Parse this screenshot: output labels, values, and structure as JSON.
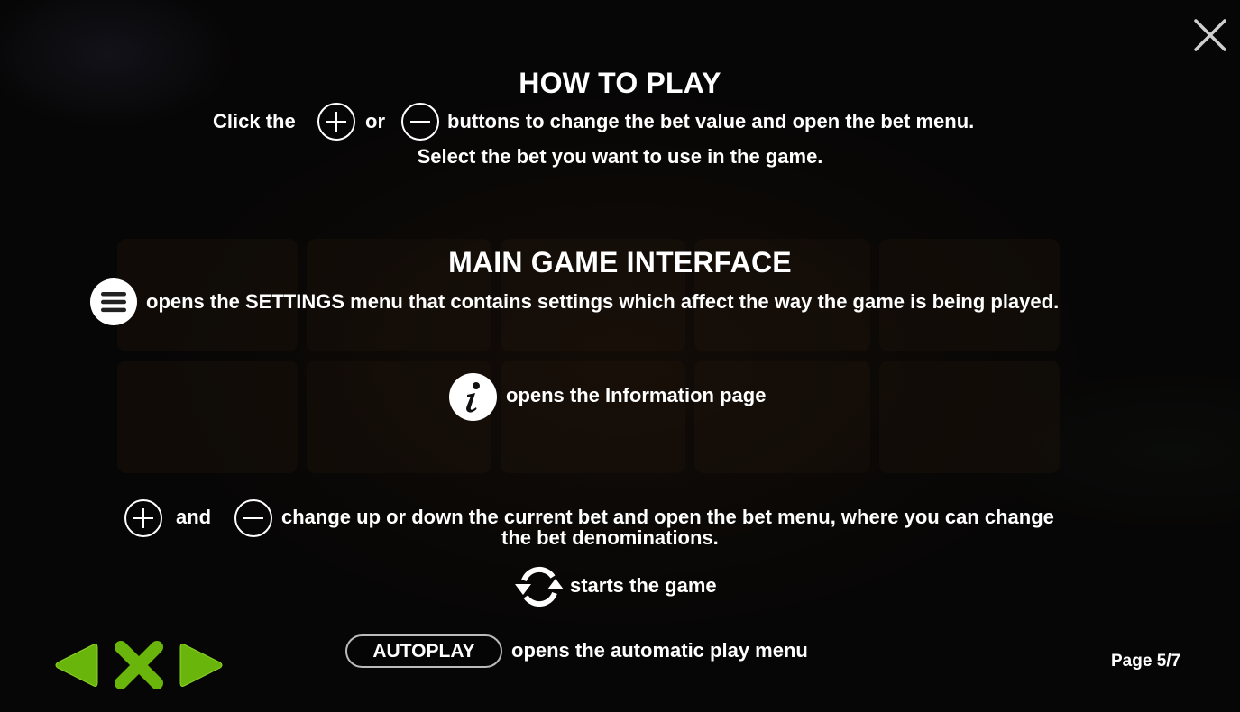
{
  "window": {
    "close_icon": "close-icon"
  },
  "how_to_play": {
    "title": "HOW TO PLAY",
    "line1_prefix": "Click the",
    "line1_or": "or",
    "line1_suffix": "buttons to change the bet value and open the bet menu.",
    "line2": "Select the bet you want to use in the game."
  },
  "main_interface": {
    "title": "MAIN GAME INTERFACE",
    "settings_text": "opens the SETTINGS menu that contains settings which affect the way the game is being played.",
    "info_text": "opens the Information page",
    "bet_and": "and",
    "bet_text_line1": "change up or down the current bet and open the bet menu, where you can change",
    "bet_text_line2": "the bet denominations.",
    "spin_text": "starts the game",
    "autoplay_label": "AUTOPLAY",
    "autoplay_text": "opens the automatic play menu"
  },
  "navigation": {
    "prev_icon": "triangle-left-icon",
    "close_icon": "x-icon",
    "next_icon": "triangle-right-icon",
    "accent_color": "#6ab50c"
  },
  "pagination": {
    "label": "Page 5/7",
    "current": 5,
    "total": 7
  }
}
